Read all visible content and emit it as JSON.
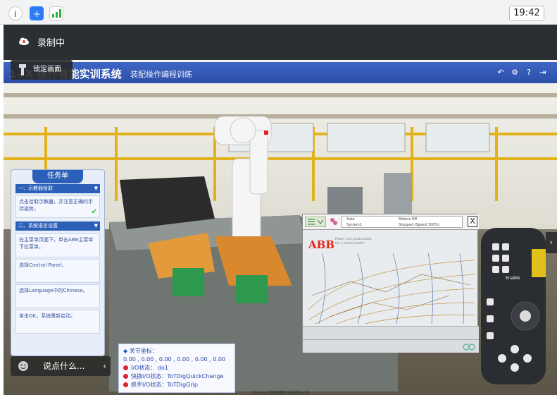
{
  "statusbar": {
    "time": "19:42"
  },
  "recording": {
    "label": "录制中"
  },
  "app": {
    "title": "1+X 操作智能实训系统",
    "subtitle": "装配操作编程训练",
    "lock_label": "锁定画面"
  },
  "task_panel": {
    "title": "任务单",
    "sections": [
      {
        "label": "一、示教器拾取"
      },
      {
        "label": "二、系统语言设置"
      }
    ],
    "steps": [
      "点击拾取示教器，并注意正确的手持姿势。",
      "在主菜单页面下，单击ABB主菜单下拉菜单。",
      "选择Control Panel。",
      "选择Language中的Chinese。",
      "单击OK，系统重新启动。"
    ]
  },
  "chat": {
    "placeholder": "说点什么..."
  },
  "status_panel": {
    "joint_label": "关节坐标：",
    "joint_values": "0.00 , 0.00 , 0.00 , 0.00 , 0.00 , 0.00",
    "io_label": "I/O状态：",
    "io_value": "do1",
    "quick_label": "快换I/O状态：",
    "quick_value": "ToTDigQuickChange",
    "grip_label": "抓手I/O状态：",
    "grip_value": "ToTDigGrip"
  },
  "pendant": {
    "mode": "Auto",
    "system": "System1",
    "motors": "Motors Off",
    "state": "Stopped (Speed 100%)",
    "brand": "ABB",
    "tagline1": "Power and productivity",
    "tagline2": "for a better world™",
    "close": "X",
    "enable_label": "Enable"
  },
  "copyright": "2022@沈阳图素科技有限公司",
  "colors": {
    "title_bar": "#2c4fa8",
    "accent": "#2c5fb8",
    "abb_red": "#e2231a"
  }
}
